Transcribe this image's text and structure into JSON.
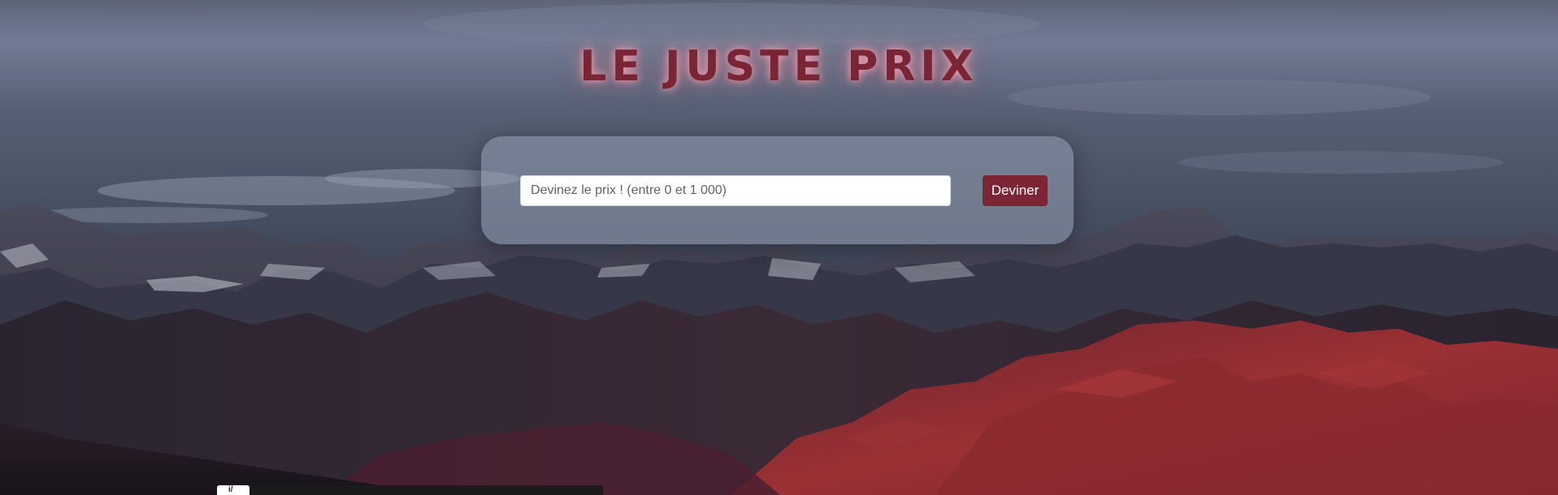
{
  "page": {
    "title": "LE JUSTE PRIX"
  },
  "form": {
    "placeholder": "Devinez le prix ! (entre 0 et 1 000)",
    "value": "",
    "submit_label": "Deviner"
  },
  "footer_tab": {
    "label": "i/"
  },
  "colors": {
    "accent": "#7c2535",
    "title": "#7a2535",
    "title_glow": "#ffaab9"
  },
  "background": {
    "icon": "mountain-landscape"
  }
}
